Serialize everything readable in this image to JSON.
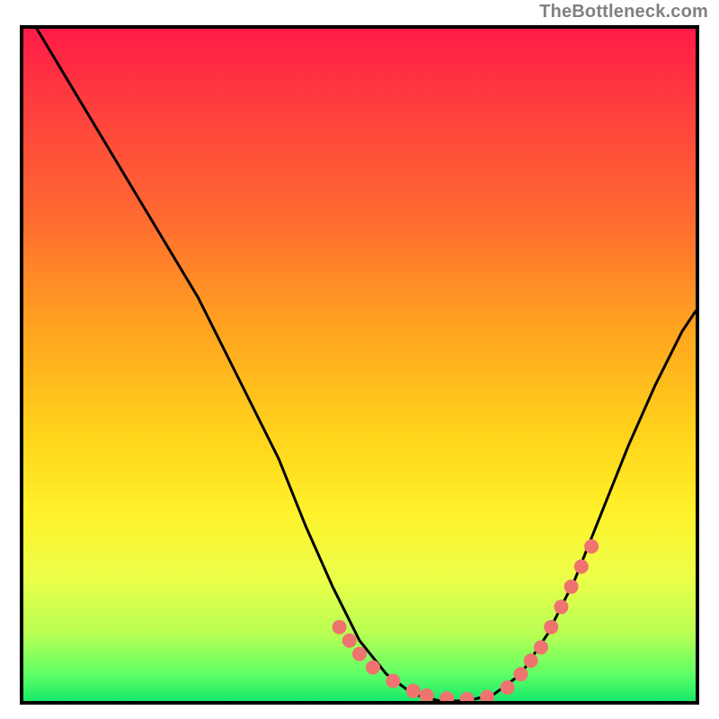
{
  "attribution": "TheBottleneck.com",
  "chart_data": {
    "type": "line",
    "title": "",
    "xlabel": "",
    "ylabel": "",
    "xlim": [
      0,
      100
    ],
    "ylim": [
      0,
      100
    ],
    "series": [
      {
        "name": "curve",
        "color": "#000000",
        "x": [
          2,
          8,
          14,
          20,
          26,
          32,
          38,
          42,
          46,
          50,
          54,
          58,
          62,
          66,
          70,
          74,
          78,
          82,
          86,
          90,
          94,
          98,
          100
        ],
        "y": [
          100,
          90,
          80,
          70,
          60,
          48,
          36,
          26,
          17,
          9,
          4,
          1,
          0,
          0,
          1,
          4,
          10,
          18,
          28,
          38,
          47,
          55,
          58
        ]
      },
      {
        "name": "dots",
        "color": "#ef736f",
        "x": [
          47,
          48.5,
          50,
          52,
          55,
          58,
          60,
          63,
          66,
          69,
          72,
          74,
          75.5,
          77,
          78.5,
          80,
          81.5,
          83,
          84.5
        ],
        "y": [
          11,
          9,
          7,
          5,
          3,
          1.5,
          0.8,
          0.4,
          0.3,
          0.6,
          2,
          4,
          6,
          8,
          11,
          14,
          17,
          20,
          23
        ]
      }
    ],
    "gradient_stops": [
      {
        "pos": 0,
        "color": "#ff1a46"
      },
      {
        "pos": 10,
        "color": "#ff3a3f"
      },
      {
        "pos": 28,
        "color": "#ff6a30"
      },
      {
        "pos": 45,
        "color": "#ffa51f"
      },
      {
        "pos": 60,
        "color": "#ffd21a"
      },
      {
        "pos": 72,
        "color": "#fff22a"
      },
      {
        "pos": 82,
        "color": "#eaff4a"
      },
      {
        "pos": 90,
        "color": "#b8ff53"
      },
      {
        "pos": 96,
        "color": "#5fff66"
      },
      {
        "pos": 100,
        "color": "#17e96a"
      }
    ]
  }
}
